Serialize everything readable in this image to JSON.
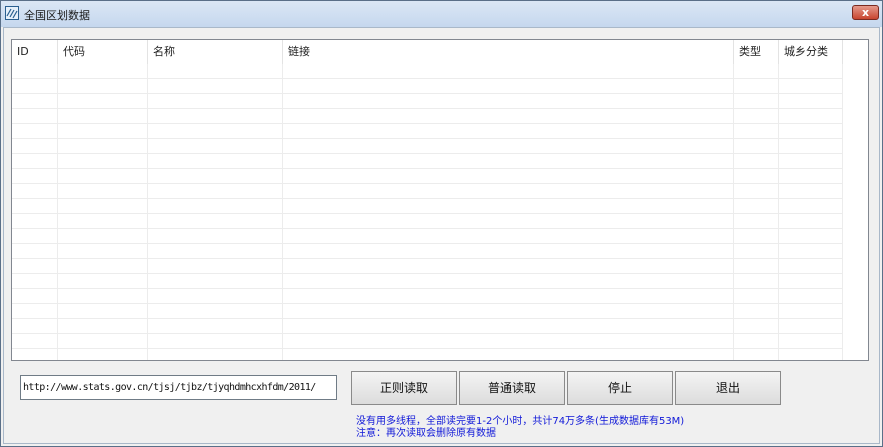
{
  "window": {
    "title": "全国区划数据",
    "close_glyph": "x"
  },
  "table": {
    "columns": [
      {
        "label": "ID"
      },
      {
        "label": "代码"
      },
      {
        "label": "名称"
      },
      {
        "label": "链接"
      },
      {
        "label": "类型"
      },
      {
        "label": "城乡分类"
      }
    ],
    "rows": []
  },
  "url_field": {
    "value": "http://www.stats.gov.cn/tjsj/tjbz/tjyqhdmhcxhfdm/2011/"
  },
  "buttons": {
    "regex_read": "正则读取",
    "normal_read": "普通读取",
    "stop": "停止",
    "exit": "退出"
  },
  "notes": {
    "line1": "没有用多线程，全部读完要1-2个小时，共计74万多条(生成数据库有53M)",
    "line2": "注意：再次读取会删除原有数据"
  },
  "colors": {
    "note_text": "#1018d8",
    "close_button": "#c8452f",
    "titlebar": "#c5d7ee"
  }
}
